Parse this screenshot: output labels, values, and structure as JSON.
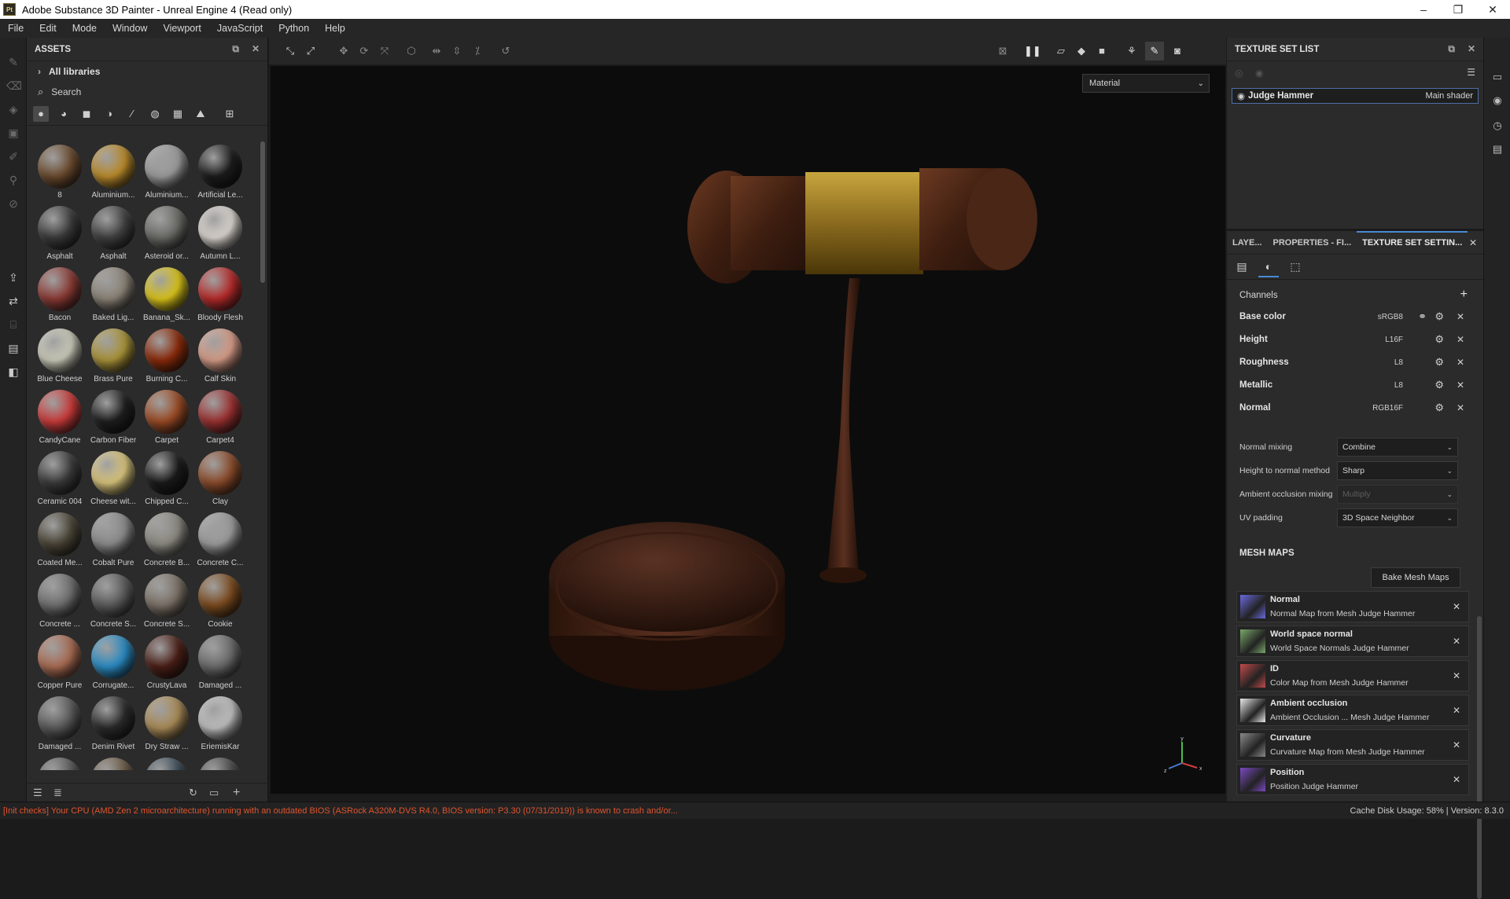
{
  "titlebar": {
    "icon_text": "Pt",
    "title": "Adobe Substance 3D Painter - Unreal Engine 4 (Read only)",
    "minimize": "–",
    "maximize": "❐",
    "close": "✕"
  },
  "menu": [
    "File",
    "Edit",
    "Mode",
    "Window",
    "Viewport",
    "JavaScript",
    "Python",
    "Help"
  ],
  "assets": {
    "title": "ASSETS",
    "libraries": "All libraries",
    "search": "Search",
    "items": [
      {
        "label": "8",
        "color": "#6a4a2e"
      },
      {
        "label": "Aluminium...",
        "color": "#b8892a"
      },
      {
        "label": "Aluminium...",
        "color": "#9a9a9a"
      },
      {
        "label": "Artificial Le...",
        "color": "#1c1c1c"
      },
      {
        "label": "Asphalt",
        "color": "#3a3a3a"
      },
      {
        "label": "Asphalt",
        "color": "#404040"
      },
      {
        "label": "Asteroid or...",
        "color": "#6a6a66"
      },
      {
        "label": "Autumn L...",
        "color": "#d8d2cc"
      },
      {
        "label": "Bacon",
        "color": "#8a3a34"
      },
      {
        "label": "Baked Lig...",
        "color": "#8a8276"
      },
      {
        "label": "Banana_Sk...",
        "color": "#d8c21a"
      },
      {
        "label": "Bloody Flesh",
        "color": "#b52a2a"
      },
      {
        "label": "Blue Cheese",
        "color": "#c8c8b8"
      },
      {
        "label": "Brass Pure",
        "color": "#a89238"
      },
      {
        "label": "Burning C...",
        "color": "#8a2a0a"
      },
      {
        "label": "Calf Skin",
        "color": "#d49a86"
      },
      {
        "label": "CandyCane",
        "color": "#c83a3a"
      },
      {
        "label": "Carbon Fiber",
        "color": "#1e1e1e"
      },
      {
        "label": "Carpet",
        "color": "#9a4a24"
      },
      {
        "label": "Carpet4",
        "color": "#9a3030"
      },
      {
        "label": "Ceramic 004",
        "color": "#3a3a3a"
      },
      {
        "label": "Cheese wit...",
        "color": "#d6c27a"
      },
      {
        "label": "Chipped C...",
        "color": "#1a1a1a"
      },
      {
        "label": "Clay",
        "color": "#8a4a2a"
      },
      {
        "label": "Coated Me...",
        "color": "#4a4436"
      },
      {
        "label": "Cobalt Pure",
        "color": "#8a8a8a"
      },
      {
        "label": "Concrete B...",
        "color": "#8a8880"
      },
      {
        "label": "Concrete C...",
        "color": "#9a9a9a"
      },
      {
        "label": "Concrete ...",
        "color": "#6e6e6e"
      },
      {
        "label": "Concrete S...",
        "color": "#5a5a5a"
      },
      {
        "label": "Concrete S...",
        "color": "#7a7066"
      },
      {
        "label": "Cookie",
        "color": "#7a4a1e"
      },
      {
        "label": "Copper Pure",
        "color": "#a86a52"
      },
      {
        "label": "Corrugate...",
        "color": "#2a8ac2"
      },
      {
        "label": "CrustyLava",
        "color": "#4a1e16"
      },
      {
        "label": "Damaged ...",
        "color": "#6a6a6a"
      },
      {
        "label": "Damaged ...",
        "color": "#5a5a5a"
      },
      {
        "label": "Denim Rivet",
        "color": "#2a2a2a"
      },
      {
        "label": "Dry Straw ...",
        "color": "#a88a56"
      },
      {
        "label": "EriemisKar",
        "color": "#bdbdbd"
      },
      {
        "label": "",
        "color": "#5a5a5a"
      },
      {
        "label": "",
        "color": "#6a5a46"
      },
      {
        "label": "",
        "color": "#3a4a56"
      },
      {
        "label": "",
        "color": "#4a4a4a"
      }
    ]
  },
  "viewport": {
    "mode_select": "Material",
    "axis": {
      "y": "y",
      "x": "x",
      "z": "z"
    }
  },
  "texture_set_list": {
    "title": "TEXTURE SET LIST",
    "item_name": "Judge Hammer",
    "item_shader": "Main shader"
  },
  "tabs": [
    "LAYE...",
    "PROPERTIES - FI...",
    "TEXTURE SET SETTIN..."
  ],
  "channels": {
    "header": "Channels",
    "rows": [
      {
        "name": "Base color",
        "format": "sRGB8"
      },
      {
        "name": "Height",
        "format": "L16F"
      },
      {
        "name": "Roughness",
        "format": "L8"
      },
      {
        "name": "Metallic",
        "format": "L8"
      },
      {
        "name": "Normal",
        "format": "RGB16F"
      }
    ]
  },
  "properties": [
    {
      "label": "Normal mixing",
      "value": "Combine",
      "disabled": false
    },
    {
      "label": "Height to normal method",
      "value": "Sharp",
      "disabled": false
    },
    {
      "label": "Ambient occlusion mixing",
      "value": "Multiply",
      "disabled": true
    },
    {
      "label": "UV padding",
      "value": "3D Space Neighbor",
      "disabled": false
    }
  ],
  "mesh_maps": {
    "header": "MESH MAPS",
    "bake_button": "Bake Mesh Maps",
    "items": [
      {
        "name": "Normal",
        "source": "Normal Map from Mesh Judge Hammer",
        "thumb": "#6a6ae0"
      },
      {
        "name": "World space normal",
        "source": "World Space Normals Judge Hammer",
        "thumb": "#7aa86a"
      },
      {
        "name": "ID",
        "source": "Color Map from Mesh Judge Hammer",
        "thumb": "#c24a4a"
      },
      {
        "name": "Ambient occlusion",
        "source": "Ambient Occlusion ... Mesh Judge Hammer",
        "thumb": "#e8e8e8"
      },
      {
        "name": "Curvature",
        "source": "Curvature Map from Mesh Judge Hammer",
        "thumb": "#8a8a8a"
      },
      {
        "name": "Position",
        "source": "Position Judge Hammer",
        "thumb": "#7a4ac2"
      }
    ]
  },
  "status": {
    "error": "[Init checks] Your CPU (AMD Zen 2 microarchitecture) running with an outdated BIOS (ASRock A320M-DVS R4.0, BIOS version: P3.30 (07/31/2019)) is known to crash and/or...",
    "right": "Cache Disk Usage:   58% | Version: 8.3.0"
  }
}
